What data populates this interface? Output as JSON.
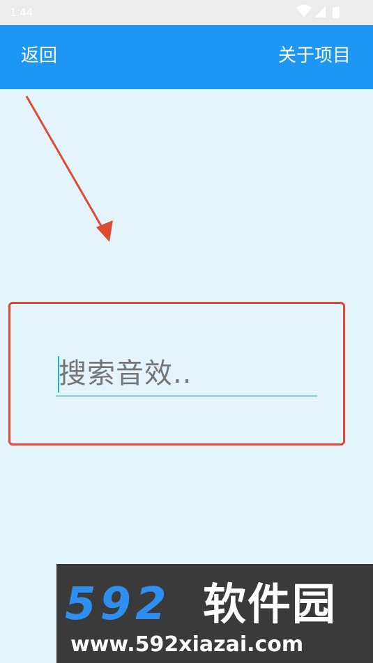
{
  "status_bar": {
    "time": "1:44",
    "icons": [
      "wifi-icon",
      "signal-icon",
      "battery-icon"
    ]
  },
  "app_bar": {
    "back_label": "返回",
    "about_label": "关于项目",
    "color": "#1e96f4"
  },
  "search": {
    "placeholder": "搜索音效.."
  },
  "annotation": {
    "color": "#de4b35"
  },
  "watermark": {
    "number": "592",
    "name": "软件园",
    "url": "www.592xiazai.com"
  }
}
